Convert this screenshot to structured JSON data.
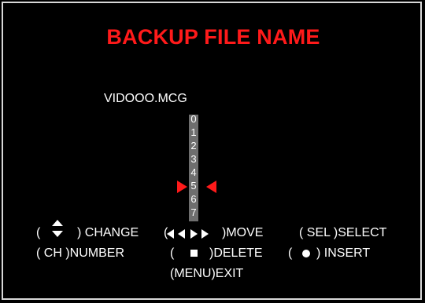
{
  "title": "BACKUP FILE NAME",
  "filename": "VIDOOO.MCG",
  "digits": [
    "0",
    "1",
    "2",
    "3",
    "4",
    "5",
    "6",
    "7"
  ],
  "selected_digit": "5",
  "colors": {
    "title": "#ff1a1a",
    "background": "#000000",
    "text": "#ffffff",
    "highlight_strip": "#6e6e6e"
  },
  "help": {
    "change": {
      "open": "(",
      "close": ") CHANGE"
    },
    "move": {
      "label": ")MOVE"
    },
    "select": {
      "label": "( SEL )SELECT"
    },
    "number": {
      "label": "( CH )NUMBER"
    },
    "delete": {
      "open": "(",
      "close": ")DELETE"
    },
    "insert": {
      "open": "(",
      "close": ") INSERT"
    },
    "exit": {
      "label": "(MENU)EXIT"
    }
  },
  "icons": {
    "change": "up-down-arrows-icon",
    "move": "left-right-arrows-icon",
    "delete": "square-stop-icon",
    "insert": "circle-dot-icon"
  }
}
